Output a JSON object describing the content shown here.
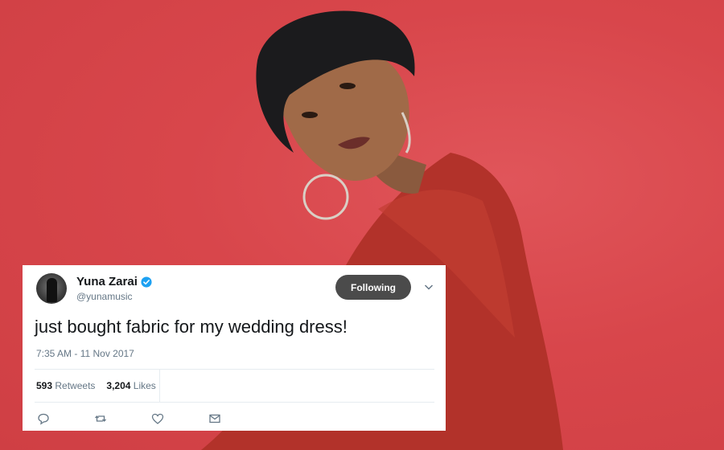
{
  "tweet": {
    "name": "Yuna Zarai",
    "handle": "@yunamusic",
    "follow_label": "Following",
    "text": "just bought fabric for my wedding dress!",
    "timestamp": "7:35 AM - 11 Nov 2017",
    "retweets_count": "593",
    "retweets_label": "Retweets",
    "likes_count": "3,204",
    "likes_label": "Likes"
  },
  "icons": {
    "verified": "verified-badge-icon",
    "caret": "chevron-down-icon",
    "reply": "reply-icon",
    "retweet": "retweet-icon",
    "like": "heart-icon",
    "dm": "envelope-icon"
  },
  "colors": {
    "background": "#d9474b",
    "verified": "#1da1f2",
    "follow_button": "#4b4b4b",
    "muted_text": "#657786"
  }
}
